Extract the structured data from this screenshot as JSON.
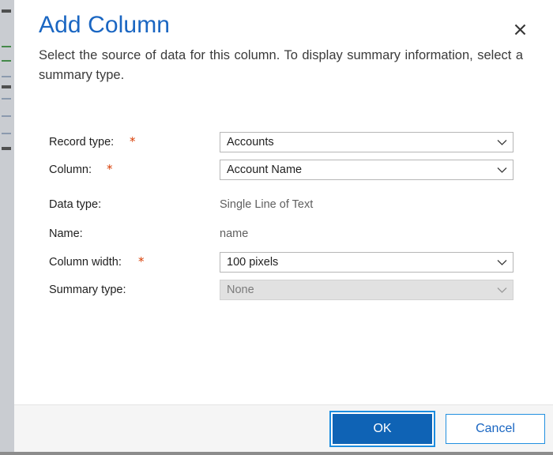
{
  "dialog": {
    "title": "Add Column",
    "subtitle": "Select the source of data for this column. To display summary information, select a summary type.",
    "close_icon": "close-icon"
  },
  "form": {
    "rows": [
      {
        "label": "Record type:",
        "required": true,
        "control": "combobox",
        "value": "Accounts",
        "disabled": false,
        "icon": "chevron-down-icon"
      },
      {
        "label": "Column:",
        "required": true,
        "control": "combobox",
        "value": "Account Name",
        "disabled": false,
        "icon": "chevron-down-icon"
      },
      {
        "label": "Data type:",
        "required": false,
        "control": "static",
        "value": "Single Line of Text"
      },
      {
        "label": "Name:",
        "required": false,
        "control": "static",
        "value": "name"
      },
      {
        "label": "Column width:",
        "required": true,
        "control": "combobox",
        "value": "100 pixels",
        "disabled": false,
        "icon": "chevron-down-icon"
      },
      {
        "label": "Summary type:",
        "required": false,
        "control": "combobox",
        "value": "None",
        "disabled": true,
        "icon": "chevron-down-icon"
      }
    ],
    "required_mark": "*"
  },
  "footer": {
    "ok_label": "OK",
    "cancel_label": "Cancel"
  },
  "colors": {
    "title_blue": "#1a66c2",
    "primary_button": "#0f63b5",
    "focus_ring": "#1c8de0",
    "required_red": "#d83b01",
    "disabled_field": "#e1e1e1",
    "footer_bg": "#f5f5f5"
  }
}
